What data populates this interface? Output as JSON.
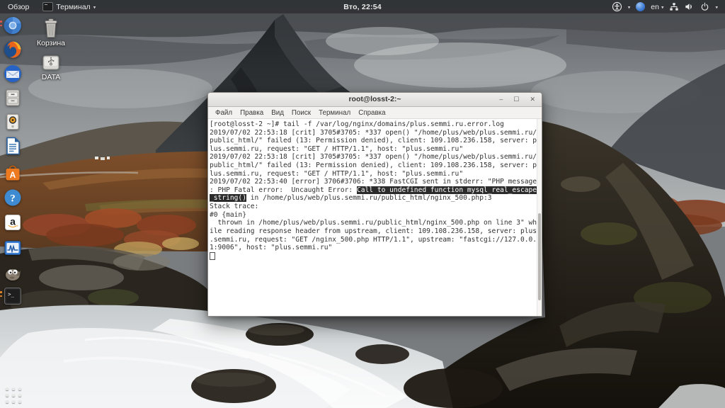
{
  "topbar": {
    "overview_label": "Обзор",
    "app_menu_label": "Терминал",
    "clock": "Вто, 22:54",
    "language": "en"
  },
  "desktop": {
    "icons": [
      {
        "name": "trash",
        "label": "Корзина"
      },
      {
        "name": "data-drive",
        "label": "DATA"
      }
    ]
  },
  "dock": {
    "items": [
      "chromium",
      "firefox",
      "thunderbird",
      "file-manager",
      "media-box",
      "libreoffice-writer",
      "software-store",
      "help",
      "amazon",
      "system-monitor",
      "gimp",
      "terminal"
    ],
    "show_apps": "show-applications"
  },
  "window": {
    "title": "root@losst-2:~",
    "controls": {
      "minimize": "–",
      "maximize": "☐",
      "close": "✕"
    },
    "menu": [
      "Файл",
      "Правка",
      "Вид",
      "Поиск",
      "Терминал",
      "Справка"
    ],
    "cursor_visible": true,
    "terminal_lines": [
      [
        {
          "t": "[root@losst-2 ~]# tail -f /var/log/nginx/domains/plus.semmi.ru.error.log"
        }
      ],
      [
        {
          "t": "2019/07/02 22:53:18 [crit] 3705#3705: *337 open() \"/home/plus/web/plus.semmi.ru/"
        }
      ],
      [
        {
          "t": "public_html/\" failed (13: Permission denied), client: 109.108.236.158, server: p"
        }
      ],
      [
        {
          "t": "lus.semmi.ru, request: \"GET / HTTP/1.1\", host: \"plus.semmi.ru\""
        }
      ],
      [
        {
          "t": "2019/07/02 22:53:18 [crit] 3705#3705: *337 open() \"/home/plus/web/plus.semmi.ru/"
        }
      ],
      [
        {
          "t": "public_html/\" failed (13: Permission denied), client: 109.108.236.158, server: p"
        }
      ],
      [
        {
          "t": "lus.semmi.ru, request: \"GET / HTTP/1.1\", host: \"plus.semmi.ru\""
        }
      ],
      [
        {
          "t": "2019/07/02 22:53:40 [error] 3706#3706: *338 FastCGI sent in stderr: \"PHP message"
        }
      ],
      [
        {
          "t": ": PHP Fatal error:  Uncaught Error: "
        },
        {
          "t": "Call to undefined function mysql_real_escape",
          "hl": true
        }
      ],
      [
        {
          "t": "_string()",
          "hl": true
        },
        {
          "t": " in /home/plus/web/plus.semmi.ru/public_html/nginx_500.php:3"
        }
      ],
      [
        {
          "t": "Stack trace:"
        }
      ],
      [
        {
          "t": "#0 {main}"
        }
      ],
      [
        {
          "t": "  thrown in /home/plus/web/plus.semmi.ru/public_html/nginx_500.php on line 3\" wh"
        }
      ],
      [
        {
          "t": "ile reading response header from upstream, client: 109.108.236.158, server: plus"
        }
      ],
      [
        {
          "t": ".semmi.ru, request: \"GET /nginx_500.php HTTP/1.1\", upstream: \"fastcgi://127.0.0."
        }
      ],
      [
        {
          "t": "1:9006\", host: \"plus.semmi.ru\""
        }
      ]
    ]
  },
  "colors": {
    "selection_bg": "#2b2b2b",
    "terminal_bg": "#ffffff",
    "terminal_fg": "#323232",
    "topbar_bg": "rgba(34,36,38,0.6)",
    "titlebar_bg": "#e8e7e5"
  }
}
